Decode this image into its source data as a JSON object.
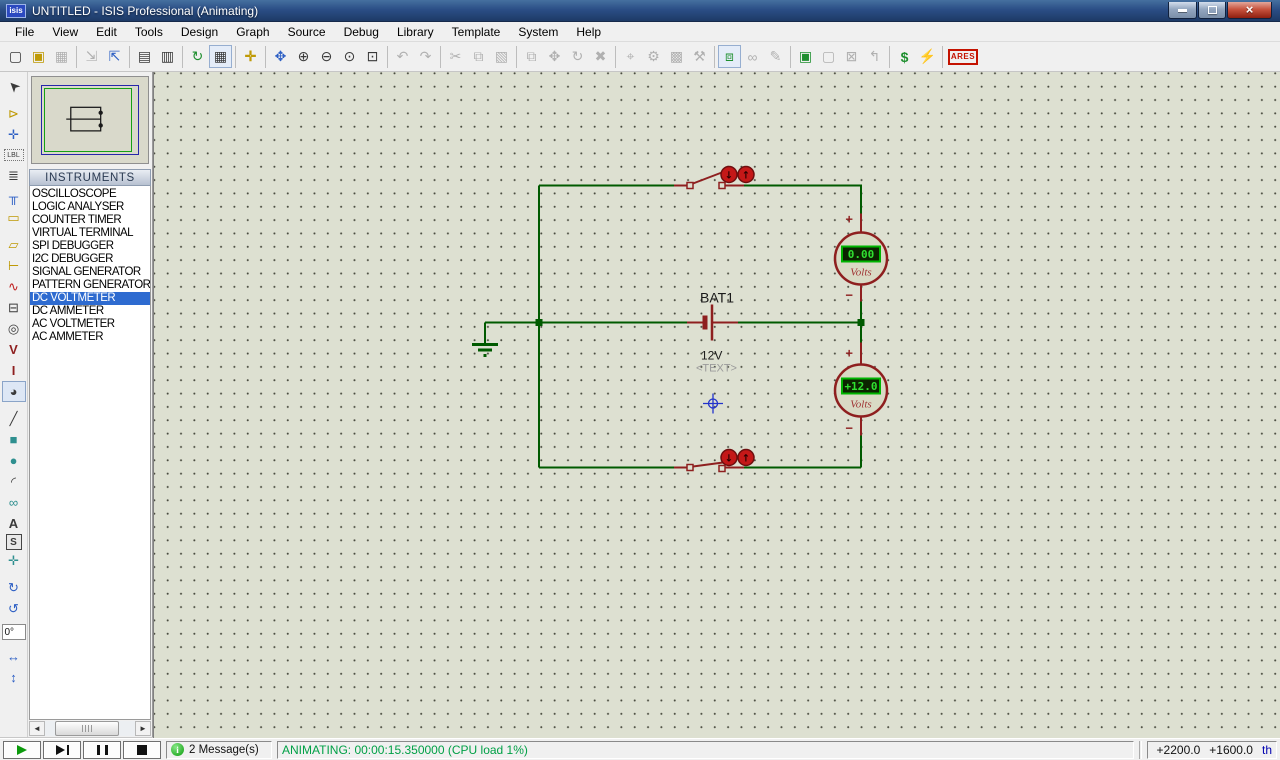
{
  "window": {
    "badge": "isis",
    "title": "UNTITLED - ISIS Professional (Animating)"
  },
  "menu": {
    "items": [
      {
        "label": "File",
        "name": "file-menu"
      },
      {
        "label": "View",
        "name": "view-menu"
      },
      {
        "label": "Edit",
        "name": "edit-menu"
      },
      {
        "label": "Tools",
        "name": "tools-menu"
      },
      {
        "label": "Design",
        "name": "design-menu"
      },
      {
        "label": "Graph",
        "name": "graph-menu"
      },
      {
        "label": "Source",
        "name": "source-menu"
      },
      {
        "label": "Debug",
        "name": "debug-menu"
      },
      {
        "label": "Library",
        "name": "library-menu"
      },
      {
        "label": "Template",
        "name": "template-menu"
      },
      {
        "label": "System",
        "name": "system-menu"
      },
      {
        "label": "Help",
        "name": "help-menu"
      }
    ]
  },
  "toolbar": {
    "icons": [
      {
        "name": "new-design-icon",
        "glyph": "▢",
        "cls": "c-dark"
      },
      {
        "name": "open-design-icon",
        "glyph": "▣",
        "cls": "c-yellow"
      },
      {
        "name": "save-design-icon",
        "glyph": "▦",
        "cls": "c-dark",
        "disabled": true
      },
      {
        "name": "separator",
        "glyph": "",
        "cls": "tsep",
        "inter": false
      },
      {
        "name": "import-section-icon",
        "glyph": "⇲",
        "cls": "c-dark",
        "disabled": true
      },
      {
        "name": "export-section-icon",
        "glyph": "⇱",
        "cls": "c-blue"
      },
      {
        "name": "separator",
        "glyph": "",
        "cls": "tsep",
        "inter": false
      },
      {
        "name": "print-icon",
        "glyph": "▤",
        "cls": "c-dark"
      },
      {
        "name": "mark-output-area-icon",
        "glyph": "▥",
        "cls": "c-dark"
      },
      {
        "name": "separator",
        "glyph": "",
        "cls": "tsep",
        "inter": false
      },
      {
        "name": "redraw-icon",
        "glyph": "↻",
        "cls": "c-green"
      },
      {
        "name": "grid-toggle-icon",
        "glyph": "▦",
        "cls": "c-dark pressed"
      },
      {
        "name": "separator",
        "glyph": "",
        "cls": "tsep",
        "inter": false
      },
      {
        "name": "origin-icon",
        "glyph": "✛",
        "cls": "c-yellow bold"
      },
      {
        "name": "separator",
        "glyph": "",
        "cls": "tsep",
        "inter": false
      },
      {
        "name": "pan-icon",
        "glyph": "✥",
        "cls": "c-blue"
      },
      {
        "name": "zoom-in-icon",
        "glyph": "⊕",
        "cls": "c-dark"
      },
      {
        "name": "zoom-out-icon",
        "glyph": "⊖",
        "cls": "c-dark"
      },
      {
        "name": "zoom-all-icon",
        "glyph": "⊙",
        "cls": "c-dark"
      },
      {
        "name": "zoom-area-icon",
        "glyph": "⊡",
        "cls": "c-dark"
      },
      {
        "name": "separator",
        "glyph": "",
        "cls": "tsep",
        "inter": false
      },
      {
        "name": "undo-icon",
        "glyph": "↶",
        "cls": "c-dark",
        "disabled": true
      },
      {
        "name": "redo-icon",
        "glyph": "↷",
        "cls": "c-dark",
        "disabled": true
      },
      {
        "name": "separator",
        "glyph": "",
        "cls": "tsep",
        "inter": false
      },
      {
        "name": "cut-icon",
        "glyph": "✂",
        "cls": "c-dark",
        "disabled": true
      },
      {
        "name": "copy-icon",
        "glyph": "⧉",
        "cls": "c-dark",
        "disabled": true
      },
      {
        "name": "paste-icon",
        "glyph": "▧",
        "cls": "c-dark",
        "disabled": true
      },
      {
        "name": "separator",
        "glyph": "",
        "cls": "tsep",
        "inter": false
      },
      {
        "name": "block-copy-icon",
        "glyph": "⧉",
        "cls": "c-dark",
        "disabled": true
      },
      {
        "name": "block-move-icon",
        "glyph": "✥",
        "cls": "c-dark",
        "disabled": true
      },
      {
        "name": "block-rotate-icon",
        "glyph": "↻",
        "cls": "c-dark",
        "disabled": true
      },
      {
        "name": "block-delete-icon",
        "glyph": "✖",
        "cls": "c-dark",
        "disabled": true
      },
      {
        "name": "separator",
        "glyph": "",
        "cls": "tsep",
        "inter": false
      },
      {
        "name": "pick-device-icon",
        "glyph": "⌖",
        "cls": "c-dark",
        "disabled": true
      },
      {
        "name": "make-device-icon",
        "glyph": "⚙",
        "cls": "c-dark",
        "disabled": true
      },
      {
        "name": "packaging-tool-icon",
        "glyph": "▩",
        "cls": "c-dark",
        "disabled": true
      },
      {
        "name": "decompose-icon",
        "glyph": "⚒",
        "cls": "c-dark",
        "disabled": true
      },
      {
        "name": "separator",
        "glyph": "",
        "cls": "tsep",
        "inter": false
      },
      {
        "name": "wire-autorouter-icon",
        "glyph": "⧈",
        "cls": "c-green pressed"
      },
      {
        "name": "search-tag-icon",
        "glyph": "∞",
        "cls": "c-dark",
        "disabled": true
      },
      {
        "name": "property-assignment-icon",
        "glyph": "✎",
        "cls": "c-dark",
        "disabled": true
      },
      {
        "name": "separator",
        "glyph": "",
        "cls": "tsep",
        "inter": false
      },
      {
        "name": "design-explorer-icon",
        "glyph": "▣",
        "cls": "c-green"
      },
      {
        "name": "new-sheet-icon",
        "glyph": "▢",
        "cls": "c-dark",
        "disabled": true
      },
      {
        "name": "remove-sheet-icon",
        "glyph": "⊠",
        "cls": "c-dark",
        "disabled": true
      },
      {
        "name": "exit-to-parent-icon",
        "glyph": "↰",
        "cls": "c-dark",
        "disabled": true
      },
      {
        "name": "separator",
        "glyph": "",
        "cls": "tsep",
        "inter": false
      },
      {
        "name": "bill-of-materials-icon",
        "glyph": "$",
        "cls": "c-green bold"
      },
      {
        "name": "electrical-rule-check-icon",
        "glyph": "⚡",
        "cls": "c-blue"
      },
      {
        "name": "separator",
        "glyph": "",
        "cls": "tsep",
        "inter": false
      },
      {
        "name": "netlist-to-ares-icon",
        "glyph": "ARES",
        "cls": "ares"
      }
    ]
  },
  "mode_toolbar": {
    "icons": [
      {
        "name": "selection-pointer-icon",
        "glyph": "➤",
        "cls": "c-dark rotCur"
      },
      {
        "name": "component-mode-icon",
        "glyph": "⊳",
        "cls": "c-yellow g"
      },
      {
        "name": "junction-dot-icon",
        "glyph": "✛",
        "cls": "c-blue"
      },
      {
        "name": "wire-label-icon",
        "glyph": "LBL",
        "cls": "c-dark tinytxt"
      },
      {
        "name": "text-script-icon",
        "glyph": "≣",
        "cls": "c-dark"
      },
      {
        "name": "buses-mode-icon",
        "glyph": "╥",
        "cls": "c-blue"
      },
      {
        "name": "subcircuit-mode-icon",
        "glyph": "▭",
        "cls": "c-yellow"
      },
      {
        "name": "terminals-mode-icon",
        "glyph": "▱",
        "cls": "c-yellow g"
      },
      {
        "name": "device-pins-icon",
        "glyph": "⊢",
        "cls": "c-yellow"
      },
      {
        "name": "graph-mode-icon",
        "glyph": "∿",
        "cls": "c-red"
      },
      {
        "name": "tape-recorder-icon",
        "glyph": "⊟",
        "cls": "c-dark"
      },
      {
        "name": "generator-mode-icon",
        "glyph": "◎",
        "cls": "c-dark"
      },
      {
        "name": "voltage-probe-icon",
        "glyph": "V",
        "cls": "c-maroon bold"
      },
      {
        "name": "current-probe-icon",
        "glyph": "I",
        "cls": "c-maroon bold"
      },
      {
        "name": "virtual-instruments-icon",
        "glyph": "◕",
        "cls": "c-dark",
        "selected": true
      },
      {
        "name": "2d-line-icon",
        "glyph": "╱",
        "cls": "c-dark g"
      },
      {
        "name": "2d-box-icon",
        "glyph": "■",
        "cls": "c-teal"
      },
      {
        "name": "2d-circle-icon",
        "glyph": "●",
        "cls": "c-teal"
      },
      {
        "name": "2d-arc-icon",
        "glyph": "◜",
        "cls": "c-dark"
      },
      {
        "name": "2d-path-icon",
        "glyph": "∞",
        "cls": "c-teal"
      },
      {
        "name": "2d-text-icon",
        "glyph": "A",
        "cls": "c-dark bold"
      },
      {
        "name": "2d-symbol-icon",
        "glyph": "S",
        "cls": "c-dark boxed"
      },
      {
        "name": "2d-marker-icon",
        "glyph": "✛",
        "cls": "c-teal"
      },
      {
        "name": "rotate-clockwise-icon",
        "glyph": "↻",
        "cls": "c-blue g"
      },
      {
        "name": "rotate-anticlockwise-icon",
        "glyph": "↺",
        "cls": "c-blue"
      },
      {
        "name": "rotation-angle-field",
        "glyph": "0°",
        "cls": "angle"
      },
      {
        "name": "mirror-horizontal-icon",
        "glyph": "↔",
        "cls": "c-blue g"
      },
      {
        "name": "mirror-vertical-icon",
        "glyph": "↕",
        "cls": "c-blue"
      }
    ]
  },
  "object_selector": {
    "header": "INSTRUMENTS",
    "instruments": [
      {
        "label": "OSCILLOSCOPE",
        "name": "instrument-oscilloscope"
      },
      {
        "label": "LOGIC ANALYSER",
        "name": "instrument-logic-analyser"
      },
      {
        "label": "COUNTER TIMER",
        "name": "instrument-counter-timer"
      },
      {
        "label": "VIRTUAL TERMINAL",
        "name": "instrument-virtual-terminal"
      },
      {
        "label": "SPI DEBUGGER",
        "name": "instrument-spi-debugger"
      },
      {
        "label": "I2C DEBUGGER",
        "name": "instrument-i2c-debugger"
      },
      {
        "label": "SIGNAL GENERATOR",
        "name": "instrument-signal-generator"
      },
      {
        "label": "PATTERN GENERATOR",
        "name": "instrument-pattern-generator"
      },
      {
        "label": "DC VOLTMETER",
        "name": "instrument-dc-voltmeter",
        "selected": true
      },
      {
        "label": "DC AMMETER",
        "name": "instrument-dc-ammeter"
      },
      {
        "label": "AC VOLTMETER",
        "name": "instrument-ac-voltmeter"
      },
      {
        "label": "AC AMMETER",
        "name": "instrument-ac-ammeter"
      }
    ]
  },
  "circuit": {
    "battery": {
      "ref": "BAT1",
      "value": "12V",
      "placeholder": "<TEXT>"
    },
    "meter_top": {
      "reading": "0.00",
      "unit": "Volts"
    },
    "meter_bottom": {
      "reading": "+12.0",
      "unit": "Volts"
    },
    "labels": {
      "plus": "+",
      "minus": "−"
    },
    "toggle_arrows": {
      "down": "↓",
      "up": "↑"
    },
    "switch_top_state": "open",
    "switch_bottom_state": "closed",
    "colors": {
      "wire": "#005a00",
      "component": "#8e1f1f",
      "lcd_text": "#30e030",
      "lcd_border": "#00b400",
      "canvas_bg": "#dde0d1"
    }
  },
  "status_bar": {
    "messages_label": "2 Message(s)",
    "status_text": "ANIMATING: 00:00:15.350000 (CPU load 1%)",
    "coord_x": "+2200.0",
    "coord_y": "+1600.0",
    "coord_unit": "th"
  }
}
